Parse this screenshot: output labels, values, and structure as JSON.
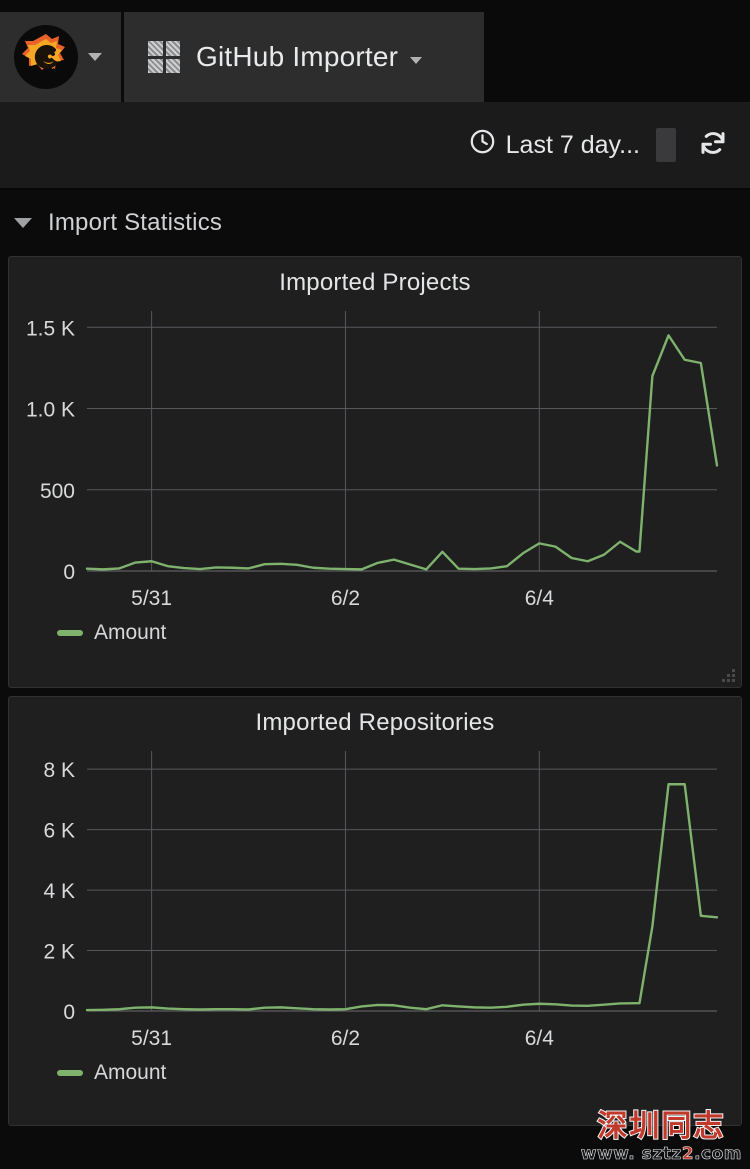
{
  "topnav": {
    "logo_icon": "grafana-logo-icon",
    "logo_caret_icon": "chevron-down-icon",
    "dashboard_icon": "dashboard-grid-icon",
    "title": "GitHub Importer",
    "title_caret_icon": "chevron-down-icon"
  },
  "subnav": {
    "clock_icon": "clock-icon",
    "time_range": "Last 7 day...",
    "zoom_out_label": "",
    "refresh_icon": "refresh-icon"
  },
  "row": {
    "chevron_icon": "chevron-down-icon",
    "title": "Import Statistics"
  },
  "colors": {
    "series_green": "#7eb26d",
    "panel_bg": "#1f1f20",
    "page_bg": "#0b0b0c",
    "grid": "#5a5a5e",
    "axis_text": "#d8d9da"
  },
  "watermark": {
    "text_cn": "深圳同志",
    "url_prefix": "www. sztz",
    "url_digit": "2",
    "url_suffix": ".com"
  },
  "panels": [
    {
      "id": "imported-projects",
      "title": "Imported Projects",
      "legend": "Amount",
      "resize_handle_icon": "resize-handle-icon"
    },
    {
      "id": "imported-repositories",
      "title": "Imported Repositories",
      "legend": "Amount"
    }
  ],
  "chart_data": [
    {
      "type": "line",
      "title": "Imported Projects",
      "xlabel": "",
      "ylabel": "",
      "ylim": [
        0,
        1600
      ],
      "yticks": [
        0,
        500,
        1000,
        1500
      ],
      "ytick_labels": [
        "0",
        "500",
        "1.0 K",
        "1.5 K"
      ],
      "xticks": [
        4,
        16,
        28
      ],
      "xtick_labels": [
        "5/31",
        "6/2",
        "6/4"
      ],
      "grid": true,
      "legend": [
        "Amount"
      ],
      "legend_position": "bottom-left",
      "series": [
        {
          "name": "Amount",
          "color": "#7eb26d",
          "x": [
            0,
            1,
            2,
            3,
            4,
            5,
            6,
            7,
            8,
            9,
            10,
            11,
            12,
            13,
            14,
            15,
            16,
            17,
            18,
            19,
            20,
            21,
            22,
            23,
            24,
            25,
            26,
            27,
            28,
            29,
            30,
            31,
            32,
            33,
            34
          ],
          "values": [
            14,
            10,
            16,
            52,
            60,
            30,
            18,
            12,
            22,
            20,
            16,
            42,
            44,
            38,
            20,
            14,
            12,
            10,
            50,
            70,
            40,
            10,
            118,
            14,
            12,
            16,
            30,
            110,
            170,
            150,
            80,
            60,
            100,
            180,
            120
          ]
        }
      ],
      "spike": {
        "note": "sharp rise just after 6/4",
        "x": [
          34.2,
          35,
          36,
          37,
          38,
          39
        ],
        "values": [
          120,
          1200,
          1450,
          1300,
          1280,
          650
        ]
      }
    },
    {
      "type": "line",
      "title": "Imported Repositories",
      "xlabel": "",
      "ylabel": "",
      "ylim": [
        0,
        8600
      ],
      "yticks": [
        0,
        2000,
        4000,
        6000,
        8000
      ],
      "ytick_labels": [
        "0",
        "2 K",
        "4 K",
        "6 K",
        "8 K"
      ],
      "xticks": [
        4,
        16,
        28
      ],
      "xtick_labels": [
        "5/31",
        "6/2",
        "6/4"
      ],
      "grid": true,
      "legend": [
        "Amount"
      ],
      "legend_position": "bottom-left",
      "series": [
        {
          "name": "Amount",
          "color": "#7eb26d",
          "x": [
            0,
            1,
            2,
            3,
            4,
            5,
            6,
            7,
            8,
            9,
            10,
            11,
            12,
            13,
            14,
            15,
            16,
            17,
            18,
            19,
            20,
            21,
            22,
            23,
            24,
            25,
            26,
            27,
            28,
            29,
            30,
            31,
            32,
            33,
            34
          ],
          "values": [
            30,
            40,
            60,
            110,
            120,
            80,
            60,
            50,
            60,
            60,
            50,
            110,
            120,
            90,
            60,
            50,
            60,
            150,
            200,
            190,
            110,
            60,
            190,
            150,
            120,
            110,
            140,
            210,
            240,
            220,
            180,
            170,
            210,
            250,
            260
          ]
        }
      ],
      "spike": {
        "note": "sharp rise through 6/4 with flat plateau at peak",
        "x": [
          34.2,
          35,
          36,
          37,
          38,
          39
        ],
        "values": [
          260,
          2800,
          7500,
          7500,
          3150,
          3100
        ]
      }
    }
  ]
}
